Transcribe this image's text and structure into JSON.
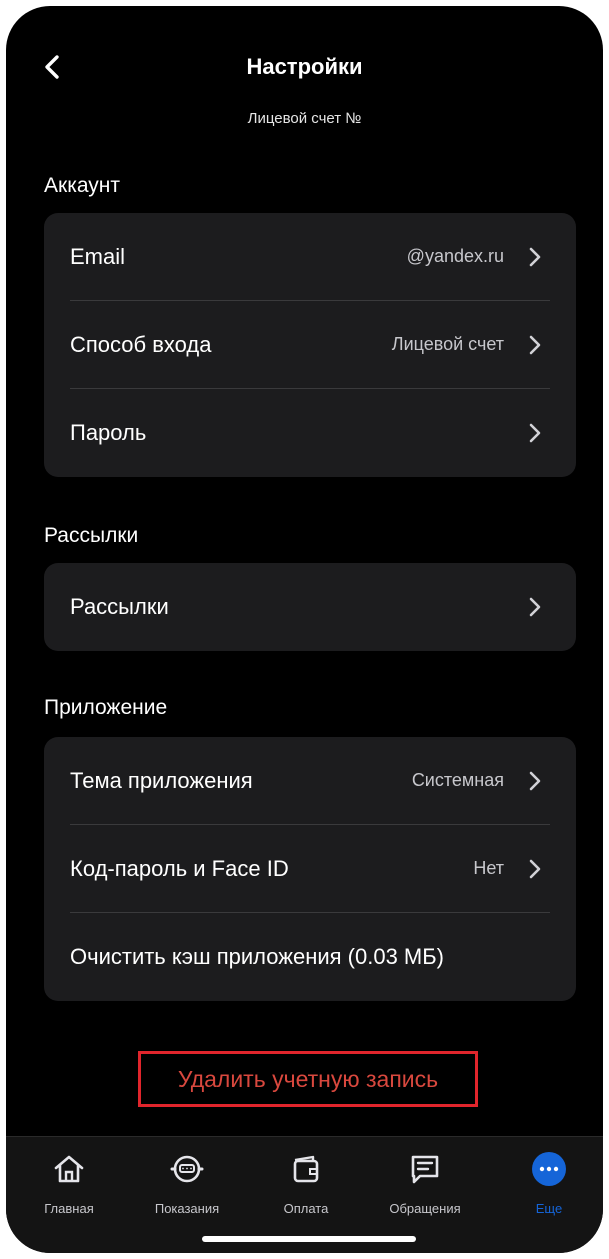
{
  "header": {
    "title": "Настройки",
    "subtitle": "Лицевой счет №"
  },
  "sections": {
    "account": {
      "title": "Аккаунт",
      "rows": [
        {
          "label": "Email",
          "value": "@yandex.ru"
        },
        {
          "label": "Способ входа",
          "value": "Лицевой счет"
        },
        {
          "label": "Пароль",
          "value": ""
        }
      ]
    },
    "mailing": {
      "title": "Рассылки",
      "rows": [
        {
          "label": "Рассылки",
          "value": ""
        }
      ]
    },
    "app": {
      "title": "Приложение",
      "rows": [
        {
          "label": "Тема приложения",
          "value": "Системная"
        },
        {
          "label": "Код-пароль и Face ID",
          "value": "Нет"
        },
        {
          "label": "Очистить кэш приложения (0.03 МБ)",
          "value": ""
        }
      ]
    }
  },
  "delete_account": {
    "label": "Удалить учетную запись",
    "color": "#d9483e"
  },
  "tabbar": {
    "tabs": [
      {
        "label": "Главная",
        "icon": "home-icon"
      },
      {
        "label": "Показания",
        "icon": "meter-icon"
      },
      {
        "label": "Оплата",
        "icon": "wallet-icon"
      },
      {
        "label": "Обращения",
        "icon": "chat-icon"
      },
      {
        "label": "Еще",
        "icon": "more-icon",
        "active": true
      }
    ]
  },
  "colors": {
    "background": "#000000",
    "card": "#1c1c1e",
    "accent": "#1565d8",
    "danger": "#e0252c"
  }
}
